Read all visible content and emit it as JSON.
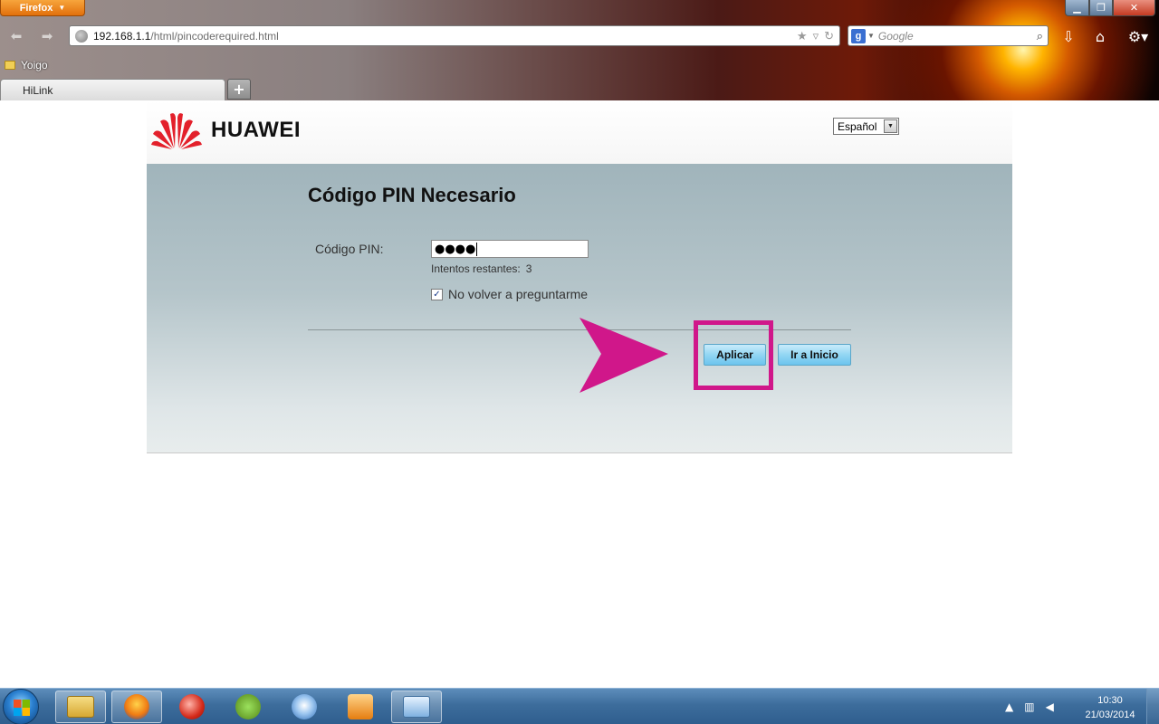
{
  "browser": {
    "menu_label": "Firefox",
    "url_host": "192.168.1.1",
    "url_path": "/html/pincoderequired.html",
    "search_placeholder": "Google",
    "bookmark": "Yoigo",
    "tab_title": "HiLink"
  },
  "header": {
    "brand": "HUAWEI",
    "language": "Español"
  },
  "form": {
    "title": "Código PIN Necesario",
    "pin_label": "Código PIN:",
    "pin_value_masked": "●●●●",
    "attempts_label": "Intentos restantes:",
    "attempts_value": "3",
    "remember_label": "No volver a preguntarme",
    "remember_checked": true,
    "apply_label": "Aplicar",
    "home_label": "Ir a Inicio"
  },
  "taskbar": {
    "time": "10:30",
    "date": "21/03/2014"
  },
  "colors": {
    "highlight": "#d0178a",
    "brand_red": "#e3202b",
    "button_blue": "#93d6f3"
  }
}
